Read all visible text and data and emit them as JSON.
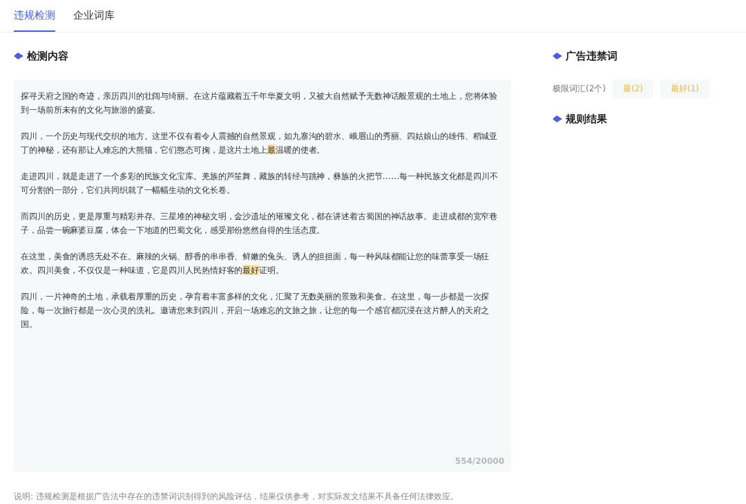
{
  "tabs": [
    {
      "label": "违规检测",
      "selected": true
    },
    {
      "label": "企业词库",
      "selected": false
    }
  ],
  "content": {
    "title": "检测内容",
    "paragraphs": [
      [
        {
          "text": "探寻天府之国的奇迹，亲历四川的壮阔与绮丽。在这片蕴藏着五千年华夏文明，又被大自然赋予无数神话般景观的土地上，您将体验到一场前所未有的文化与旅游的盛宴。",
          "highlighted": false
        }
      ],
      [
        {
          "text": "四川，一个历史与现代交织的地方。这里不仅有着令人震撼的自然景观，如九寨沟的碧水、峨眉山的秀丽、四姑娘山的雄伟、稻城亚丁的神秘，还有那让人难忘的大熊猫，它们憨态可掬，是这片土地上",
          "highlighted": false
        },
        {
          "text": "最",
          "highlighted": true
        },
        {
          "text": "温暖的使者。",
          "highlighted": false
        }
      ],
      [
        {
          "text": "走进四川，就是走进了一个多彩的民族文化宝库。羌族的芦笙舞，藏族的转经与跳神，彝族的火把节……每一种民族文化都是四川不可分割的一部分，它们共同织就了一幅幅生动的文化长卷。",
          "highlighted": false
        }
      ],
      [
        {
          "text": "而四川的历史，更是厚重与精彩并存。三星堆的神秘文明，金沙遗址的璀璨文化，都在讲述着古蜀国的神话故事。走进成都的宽窄巷子，品尝一碗麻婆豆腐，体会一下地道的巴蜀文化，感受那份悠然自得的生活态度。",
          "highlighted": false
        }
      ],
      [
        {
          "text": "在这里，美食的诱惑无处不在。麻辣的火锅、醇香的串串香、鲜嫩的兔头、诱人的担担面，每一种风味都能让您的味蕾享受一场狂欢。四川美食，不仅仅是一种味道，它是四川人民热情好客的",
          "highlighted": false
        },
        {
          "text": "最好",
          "highlighted": true
        },
        {
          "text": "证明。",
          "highlighted": false
        }
      ],
      [
        {
          "text": "四川，一片神奇的土地，承载着厚重的历史，孕育着丰富多样的文化，汇聚了无数美丽的景致和美食。在这里，每一步都是一次探险，每一次旅行都是一次心灵的洗礼。邀请您来到四川，开启一场难忘的文旅之旅，让您的每一个感官都沉浸在这片醉人的天府之国。",
          "highlighted": false
        }
      ]
    ],
    "counter": "554/20000"
  },
  "banned_words": {
    "title": "广告违禁词",
    "category": "极限词汇(2个)",
    "tags": [
      "最(2)",
      "最好(1)"
    ]
  },
  "rule_results": {
    "title": "规则结果"
  },
  "note": "说明: 违规检测是根据广告法中存在的违禁词识别得到的风险评估，结果仅供参考，对实际发文结果不具备任何法律效应。"
}
